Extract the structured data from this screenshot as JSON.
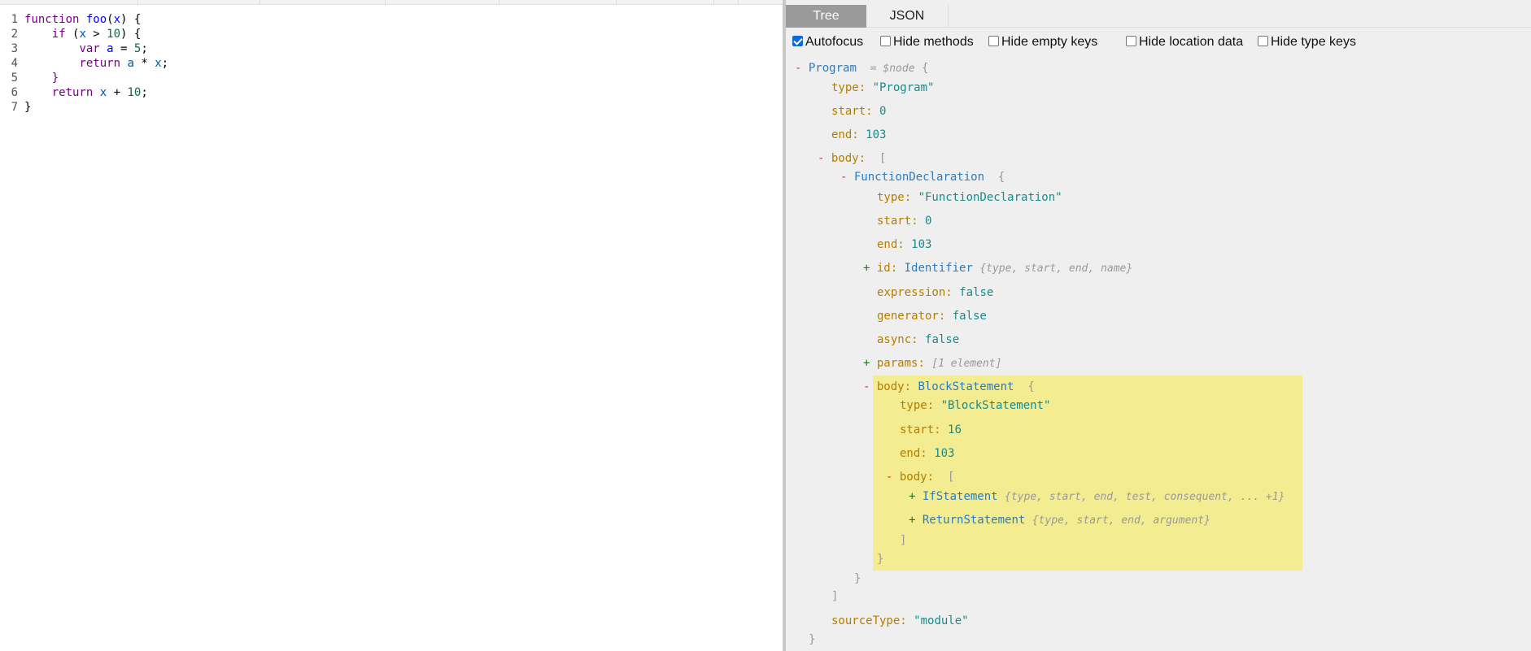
{
  "editor": {
    "lines": [
      {
        "n": "1",
        "tokens": [
          {
            "t": "function",
            "c": "kw"
          },
          {
            "t": " ",
            "c": "op"
          },
          {
            "t": "foo",
            "c": "def"
          },
          {
            "t": "(",
            "c": "op"
          },
          {
            "t": "x",
            "c": "def"
          },
          {
            "t": ") {",
            "c": "op"
          }
        ]
      },
      {
        "n": "2",
        "tokens": [
          {
            "t": "    ",
            "c": "op"
          },
          {
            "t": "if",
            "c": "kw"
          },
          {
            "t": " (",
            "c": "op"
          },
          {
            "t": "x",
            "c": "var2"
          },
          {
            "t": " > ",
            "c": "op"
          },
          {
            "t": "10",
            "c": "num"
          },
          {
            "t": ") {",
            "c": "op"
          }
        ]
      },
      {
        "n": "3",
        "tokens": [
          {
            "t": "        ",
            "c": "op"
          },
          {
            "t": "var",
            "c": "kw"
          },
          {
            "t": " ",
            "c": "op"
          },
          {
            "t": "a",
            "c": "def"
          },
          {
            "t": " = ",
            "c": "op"
          },
          {
            "t": "5",
            "c": "num"
          },
          {
            "t": ";",
            "c": "op"
          }
        ]
      },
      {
        "n": "4",
        "tokens": [
          {
            "t": "        ",
            "c": "op"
          },
          {
            "t": "return",
            "c": "kw"
          },
          {
            "t": " ",
            "c": "op"
          },
          {
            "t": "a",
            "c": "var2"
          },
          {
            "t": " * ",
            "c": "op"
          },
          {
            "t": "x",
            "c": "var2"
          },
          {
            "t": ";",
            "c": "op"
          }
        ]
      },
      {
        "n": "5",
        "tokens": [
          {
            "t": "    ",
            "c": "op"
          },
          {
            "t": "}",
            "c": "kw"
          }
        ]
      },
      {
        "n": "6",
        "tokens": [
          {
            "t": "    ",
            "c": "op"
          },
          {
            "t": "return",
            "c": "kw"
          },
          {
            "t": " ",
            "c": "op"
          },
          {
            "t": "x",
            "c": "var2"
          },
          {
            "t": " + ",
            "c": "op"
          },
          {
            "t": "10",
            "c": "num"
          },
          {
            "t": ";",
            "c": "op"
          }
        ]
      },
      {
        "n": "7",
        "tokens": [
          {
            "t": "}",
            "c": "op"
          }
        ]
      }
    ]
  },
  "tabs": {
    "tree": "Tree",
    "json": "JSON"
  },
  "options": [
    {
      "label": "Autofocus",
      "checked": true
    },
    {
      "label": "Hide methods",
      "checked": false
    },
    {
      "label": "Hide empty keys",
      "checked": false
    },
    {
      "label": "Hide location data",
      "checked": false
    },
    {
      "label": "Hide type keys",
      "checked": false
    }
  ],
  "tree": {
    "program": {
      "toggle": "-",
      "label": "Program",
      "meta": "= $node",
      "open": "{"
    },
    "type": {
      "key": "type",
      "value": "\"Program\""
    },
    "start": {
      "key": "start",
      "value": "0"
    },
    "end": {
      "key": "end",
      "value": "103"
    },
    "body": {
      "toggle": "-",
      "key": "body",
      "open": "["
    },
    "fn": {
      "toggle": "-",
      "label": "FunctionDeclaration",
      "open": "{"
    },
    "fn_type": {
      "key": "type",
      "value": "\"FunctionDeclaration\""
    },
    "fn_start": {
      "key": "start",
      "value": "0"
    },
    "fn_end": {
      "key": "end",
      "value": "103"
    },
    "fn_id": {
      "toggle": "+",
      "key": "id",
      "label": "Identifier",
      "summary": "{type, start, end, name}"
    },
    "fn_expression": {
      "key": "expression",
      "value": "false"
    },
    "fn_generator": {
      "key": "generator",
      "value": "false"
    },
    "fn_async": {
      "key": "async",
      "value": "false"
    },
    "fn_params": {
      "toggle": "+",
      "key": "params",
      "summary": "[1 element]"
    },
    "fn_body": {
      "toggle": "-",
      "key": "body",
      "label": "BlockStatement",
      "open": "{"
    },
    "bs_type": {
      "key": "type",
      "value": "\"BlockStatement\""
    },
    "bs_start": {
      "key": "start",
      "value": "16"
    },
    "bs_end": {
      "key": "end",
      "value": "103"
    },
    "bs_body": {
      "toggle": "-",
      "key": "body",
      "open": "["
    },
    "if_stmt": {
      "toggle": "+",
      "label": "IfStatement",
      "summary": "{type, start, end, test, consequent, ... +1}"
    },
    "ret_stmt": {
      "toggle": "+",
      "label": "ReturnStatement",
      "summary": "{type, start, end, argument}"
    },
    "close_bracket": "]",
    "close_brace": "}",
    "source_type": {
      "key": "sourceType",
      "value": "\"module\""
    }
  }
}
